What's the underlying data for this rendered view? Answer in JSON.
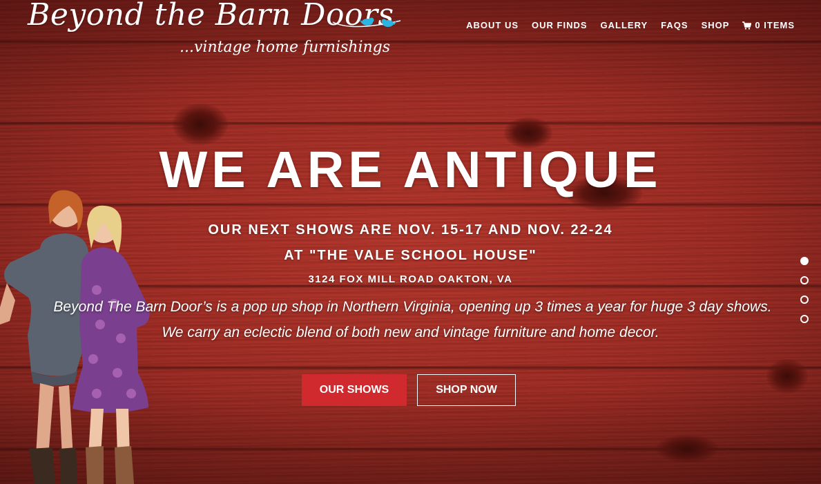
{
  "logo": {
    "title": "Beyond the Barn Doors",
    "tagline": "...vintage home furnishings"
  },
  "nav": {
    "items": [
      "ABOUT US",
      "OUR FINDS",
      "GALLERY",
      "FAQS",
      "SHOP"
    ],
    "cart_label": "0 ITEMS"
  },
  "hero": {
    "headline": "WE ARE ANTIQUE",
    "shows_line": "OUR NEXT SHOWS ARE NOV. 15-17 AND NOV. 22-24",
    "venue_line": "AT \"THE VALE SCHOOL HOUSE\"",
    "address": "3124 FOX MILL ROAD OAKTON, VA",
    "description_line1": "Beyond The Barn Door’s is a pop up shop in Northern Virginia, opening up 3 times a year for huge 3 day shows.",
    "description_line2": "We carry an eclectic blend of both new and vintage furniture and home decor.",
    "button_shows": "OUR SHOWS",
    "button_shop": "SHOP NOW"
  },
  "slider": {
    "slide_count": 4,
    "active_index": 0
  },
  "colors": {
    "barn_red": "#a82f26",
    "button_red": "#d02a2f",
    "bird_blue": "#2cb5e0",
    "text": "#ffffff"
  }
}
